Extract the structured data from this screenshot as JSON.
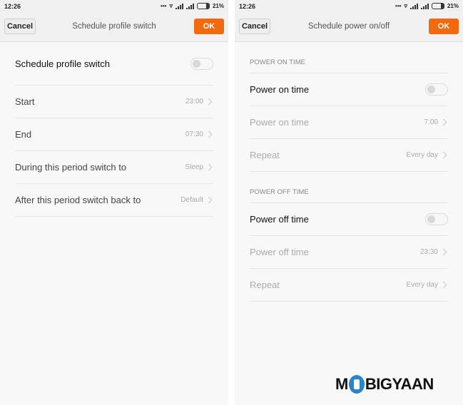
{
  "left": {
    "status": {
      "time": "12:26",
      "dots": "•••",
      "battery": "21%"
    },
    "toolbar": {
      "cancel_label": "Cancel",
      "title": "Schedule profile switch",
      "ok_label": "OK"
    },
    "toggle_row": {
      "label": "Schedule profile switch",
      "enabled": false
    },
    "rows": [
      {
        "label": "Start",
        "value": "23:00"
      },
      {
        "label": "End",
        "value": "07:30"
      },
      {
        "label": "During this period switch to",
        "value": "Sleep"
      },
      {
        "label": "After this period switch back to",
        "value": "Default"
      }
    ]
  },
  "right": {
    "status": {
      "time": "12:26",
      "dots": "•••",
      "battery": "21%"
    },
    "toolbar": {
      "cancel_label": "Cancel",
      "title": "Schedule power on/off",
      "ok_label": "OK"
    },
    "power_on": {
      "header": "POWER ON TIME",
      "toggle_label": "Power on time",
      "enabled": false,
      "time_label": "Power on time",
      "time_value": "7:00",
      "repeat_label": "Repeat",
      "repeat_value": "Every day"
    },
    "power_off": {
      "header": "POWER OFF TIME",
      "toggle_label": "Power off time",
      "enabled": false,
      "time_label": "Power off time",
      "time_value": "23:30",
      "repeat_label": "Repeat",
      "repeat_value": "Every day"
    }
  },
  "watermark": {
    "text_before": "M",
    "text_after": "BIGYAAN"
  },
  "colors": {
    "accent": "#f26a0f",
    "logo_blue": "#2a84c9"
  }
}
